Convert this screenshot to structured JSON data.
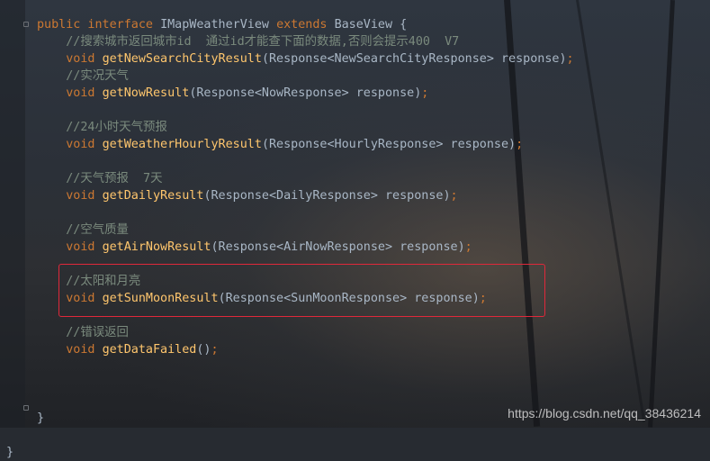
{
  "editor": {
    "lines": [
      {
        "tokens": [
          {
            "text": "public interface ",
            "cls": "kw"
          },
          {
            "text": "IMapWeatherView ",
            "cls": "id"
          },
          {
            "text": "extends ",
            "cls": "kw"
          },
          {
            "text": "BaseView {",
            "cls": "id"
          }
        ]
      },
      {
        "tokens": [
          {
            "text": "    //搜索城市返回城市id  通过id才能查下面的数据,否则会提示400  V7",
            "cls": "cm"
          }
        ]
      },
      {
        "tokens": [
          {
            "text": "    void ",
            "cls": "kw"
          },
          {
            "text": "getNewSearchCityResult",
            "cls": "fn"
          },
          {
            "text": "(Response<NewSearchCityResponse> response)",
            "cls": "id"
          },
          {
            "text": ";",
            "cls": "kw"
          }
        ]
      },
      {
        "tokens": [
          {
            "text": "    //实况天气",
            "cls": "cm"
          }
        ]
      },
      {
        "tokens": [
          {
            "text": "    void ",
            "cls": "kw"
          },
          {
            "text": "getNowResult",
            "cls": "fn"
          },
          {
            "text": "(Response<NowResponse> response)",
            "cls": "id"
          },
          {
            "text": ";",
            "cls": "kw"
          }
        ]
      },
      {
        "tokens": []
      },
      {
        "tokens": [
          {
            "text": "    //24小时天气预报",
            "cls": "cm"
          }
        ]
      },
      {
        "tokens": [
          {
            "text": "    void ",
            "cls": "kw"
          },
          {
            "text": "getWeatherHourlyResult",
            "cls": "fn"
          },
          {
            "text": "(Response<HourlyResponse> response)",
            "cls": "id"
          },
          {
            "text": ";",
            "cls": "kw"
          }
        ]
      },
      {
        "tokens": []
      },
      {
        "tokens": [
          {
            "text": "    //天气预报  7天",
            "cls": "cm"
          }
        ]
      },
      {
        "tokens": [
          {
            "text": "    void ",
            "cls": "kw"
          },
          {
            "text": "getDailyResult",
            "cls": "fn"
          },
          {
            "text": "(Response<DailyResponse> response)",
            "cls": "id"
          },
          {
            "text": ";",
            "cls": "kw"
          }
        ]
      },
      {
        "tokens": []
      },
      {
        "tokens": [
          {
            "text": "    //空气质量",
            "cls": "cm"
          }
        ]
      },
      {
        "tokens": [
          {
            "text": "    void ",
            "cls": "kw"
          },
          {
            "text": "getAirNowResult",
            "cls": "fn"
          },
          {
            "text": "(Response<AirNowResponse> response)",
            "cls": "id"
          },
          {
            "text": ";",
            "cls": "kw"
          }
        ]
      },
      {
        "tokens": []
      },
      {
        "tokens": [
          {
            "text": "    //太阳和月亮",
            "cls": "cm"
          }
        ]
      },
      {
        "tokens": [
          {
            "text": "    void ",
            "cls": "kw"
          },
          {
            "text": "getSunMoonResult",
            "cls": "fn"
          },
          {
            "text": "(Response<SunMoonResponse> response)",
            "cls": "id"
          },
          {
            "text": ";",
            "cls": "kw"
          }
        ]
      },
      {
        "tokens": []
      },
      {
        "tokens": [
          {
            "text": "    //错误返回",
            "cls": "cm"
          }
        ]
      },
      {
        "tokens": [
          {
            "text": "    void ",
            "cls": "kw"
          },
          {
            "text": "getDataFailed",
            "cls": "fn"
          },
          {
            "text": "()",
            "cls": "id"
          },
          {
            "text": ";",
            "cls": "kw"
          }
        ]
      },
      {
        "tokens": []
      },
      {
        "tokens": []
      },
      {
        "tokens": []
      },
      {
        "tokens": [
          {
            "text": "}",
            "cls": "id"
          }
        ]
      },
      {
        "tokens": []
      },
      {
        "tokens": [
          {
            "text": "}",
            "cls": "id"
          }
        ]
      }
    ]
  },
  "watermark": "https://blog.csdn.net/qq_38436214",
  "colors": {
    "keyword": "#cc7832",
    "identifier": "#a9b7c6",
    "method": "#ffc66d",
    "comment": "#7a8a7d",
    "highlight_box": "#e0283a"
  }
}
